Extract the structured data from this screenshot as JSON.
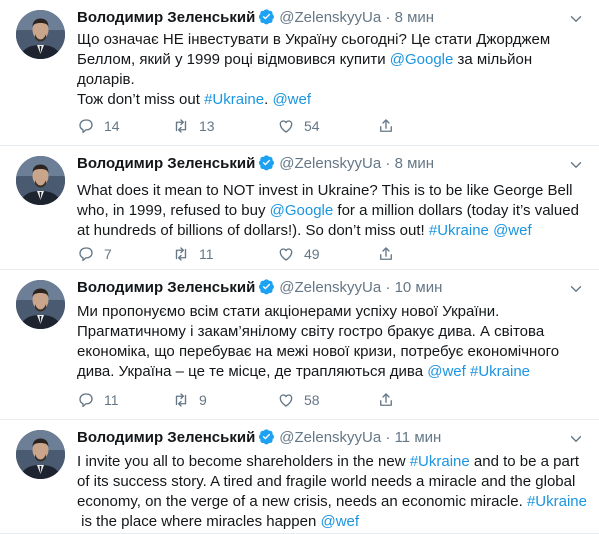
{
  "tweets": [
    {
      "name": "Володимир Зеленський",
      "handle": "@ZelenskyyUa",
      "sep": "·",
      "time": "8 мин",
      "lines": [
        [
          {
            "t": "Що означає НЕ інвестувати в Україну сьогодні? Це стати Джорджем"
          }
        ],
        [
          {
            "t": "Беллом, який у 1999 році відмовився купити "
          },
          {
            "t": "@Google",
            "link": true
          },
          {
            "t": " за мільйон"
          }
        ],
        [
          {
            "t": "доларів."
          }
        ],
        [
          {
            "t": "Тож don’t miss out "
          },
          {
            "t": "#Ukraine",
            "link": true
          },
          {
            "t": ". "
          },
          {
            "t": "@wef",
            "link": true
          }
        ]
      ],
      "replies": "14",
      "retweets": "13",
      "likes": "54"
    },
    {
      "name": "Володимир Зеленський",
      "handle": "@ZelenskyyUa",
      "sep": "·",
      "time": "8 мин",
      "lines": [
        [
          {
            "t": "What does it mean to NOT invest in Ukraine? This is to be like George Bell"
          }
        ],
        [
          {
            "t": "who, in 1999, refused to buy "
          },
          {
            "t": "@Google",
            "link": true
          },
          {
            "t": " for a million dollars (today it’s valued"
          }
        ],
        [
          {
            "t": "at hundreds of billions of dollars!). So don’t miss out! "
          },
          {
            "t": "#Ukraine",
            "link": true
          },
          {
            "t": " "
          },
          {
            "t": "@wef",
            "link": true
          }
        ]
      ],
      "replies": "7",
      "retweets": "11",
      "likes": "49"
    },
    {
      "name": "Володимир Зеленський",
      "handle": "@ZelenskyyUa",
      "sep": "·",
      "time": "10 мин",
      "lines": [
        [
          {
            "t": "Ми пропонуємо всім стати акціонерами успіху нової України."
          }
        ],
        [
          {
            "t": "Прагматичному і закам’янілому світу гостро бракує дива. А світова"
          }
        ],
        [
          {
            "t": "економіка, що перебуває на межі нової кризи, потребує економічного"
          }
        ],
        [
          {
            "t": "дива. Україна – це те місце, де трапляються дива "
          },
          {
            "t": "@wef",
            "link": true
          },
          {
            "t": " "
          },
          {
            "t": "#Ukraine",
            "link": true
          }
        ]
      ],
      "replies": "11",
      "retweets": "9",
      "likes": "58"
    },
    {
      "name": "Володимир Зеленський",
      "handle": "@ZelenskyyUa",
      "sep": "·",
      "time": "11 мин",
      "lines": [
        [
          {
            "t": "I invite you all to become shareholders in the new "
          },
          {
            "t": "#Ukraine",
            "link": true
          },
          {
            "t": " and to be a part"
          }
        ],
        [
          {
            "t": "of its success story. A tired and fragile world needs a miracle and the global"
          }
        ],
        [
          {
            "t": "economy, on the verge of a new crisis, needs an economic miracle. "
          },
          {
            "t": "#Ukraine",
            "link": true
          }
        ],
        [
          {
            "t": " is the place where miracles happen "
          },
          {
            "t": "@wef",
            "link": true
          }
        ]
      ]
    }
  ],
  "colors": {
    "link": "#1b95e0",
    "muted": "#657786",
    "verified": "#1da1f2"
  },
  "icons": {
    "reply": "reply-icon",
    "retweet": "retweet-icon",
    "like": "heart-icon",
    "share": "share-icon",
    "menu": "chevron-down-icon",
    "verified": "verified-badge-icon"
  }
}
